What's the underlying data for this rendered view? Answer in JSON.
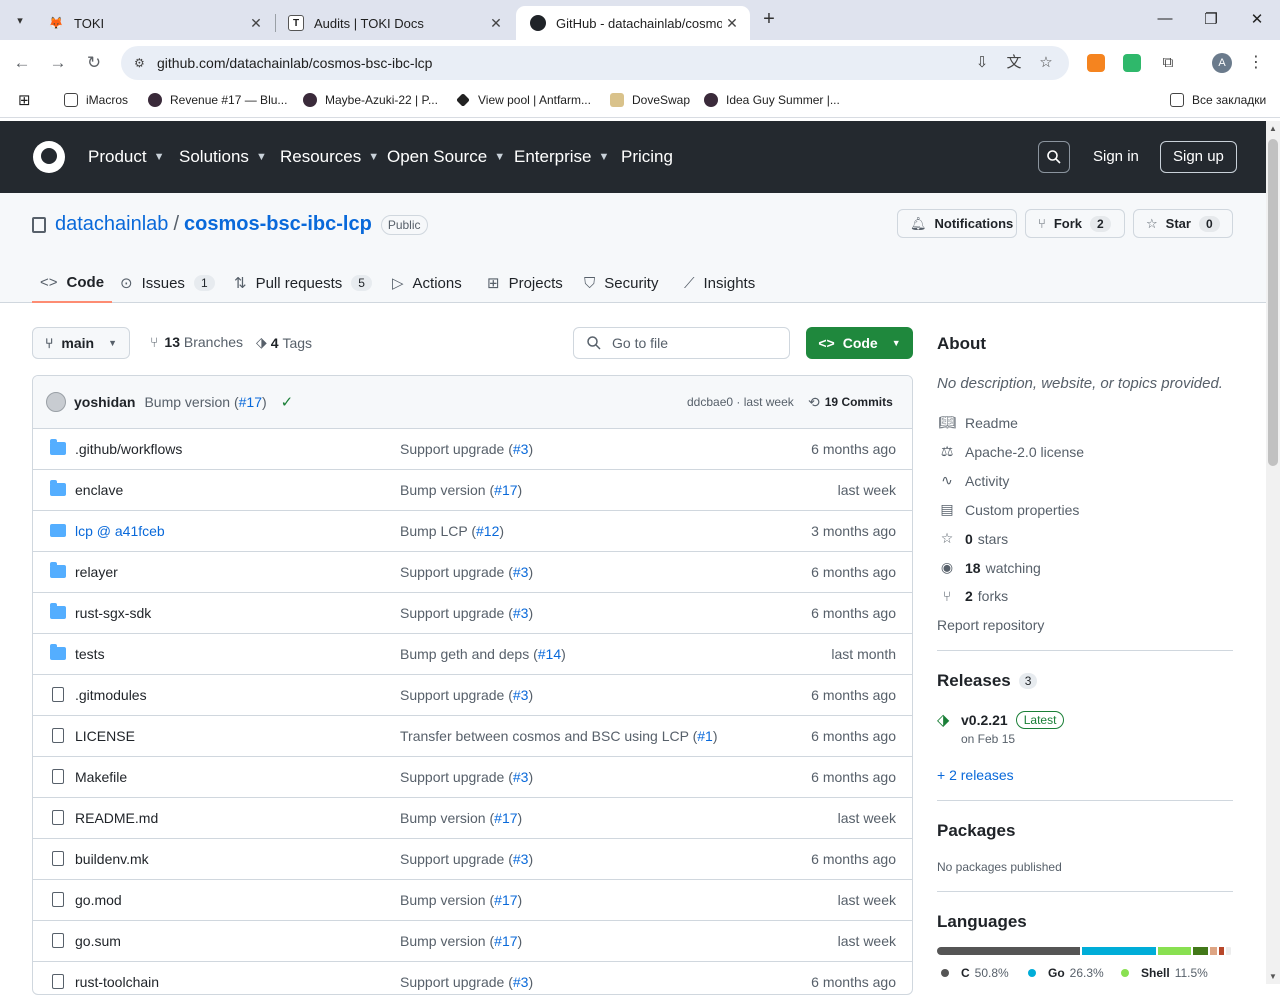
{
  "browser": {
    "tabs": [
      {
        "title": "TOKI",
        "favicon": "toki-fox-icon"
      },
      {
        "title": "Audits | TOKI Docs",
        "favicon": "T"
      },
      {
        "title": "GitHub - datachainlab/cosmos-",
        "favicon": "github-icon"
      }
    ],
    "url": "github.com/datachainlab/cosmos-bsc-ibc-lcp",
    "profile_initial": "A",
    "bookmarks": [
      {
        "label": "iMacros"
      },
      {
        "label": "Revenue #17 — Blu..."
      },
      {
        "label": "Maybe-Azuki-22 | P..."
      },
      {
        "label": "View pool | Antfarm..."
      },
      {
        "label": "DoveSwap"
      },
      {
        "label": "Idea Guy Summer |..."
      }
    ],
    "all_bookmarks": "Все закладки"
  },
  "gh_nav": {
    "product": "Product",
    "solutions": "Solutions",
    "resources": "Resources",
    "open_source": "Open Source",
    "enterprise": "Enterprise",
    "pricing": "Pricing",
    "sign_in": "Sign in",
    "sign_up": "Sign up"
  },
  "repo": {
    "owner": "datachainlab",
    "name": "cosmos-bsc-ibc-lcp",
    "visibility": "Public",
    "notifications": "Notifications",
    "fork_label": "Fork",
    "fork_count": "2",
    "star_label": "Star",
    "star_count": "0"
  },
  "repo_tabs": {
    "code": "Code",
    "issues": "Issues",
    "issues_count": "1",
    "pulls": "Pull requests",
    "pulls_count": "5",
    "actions": "Actions",
    "projects": "Projects",
    "security": "Security",
    "insights": "Insights"
  },
  "controls": {
    "branch": "main",
    "branches_count": "13",
    "branches_label": "Branches",
    "tags_count": "4",
    "tags_label": "Tags",
    "goto_placeholder": "Go to file",
    "code_button": "Code"
  },
  "latest_commit": {
    "author": "yoshidan",
    "message": "Bump version (",
    "pr": "#17",
    "message_end": ")",
    "sha": "ddcbae0",
    "sep": "·",
    "time": "last week",
    "commits_count": "19",
    "commits_label": "Commits"
  },
  "files": [
    {
      "name": ".github/workflows",
      "type": "dir",
      "msg": "Support upgrade (",
      "pr": "#3",
      "age": "6 months ago"
    },
    {
      "name": "enclave",
      "type": "dir",
      "msg": "Bump version (",
      "pr": "#17",
      "age": "last week"
    },
    {
      "name": "lcp @ a41fceb",
      "type": "sub",
      "msg": "Bump LCP (",
      "pr": "#12",
      "age": "3 months ago"
    },
    {
      "name": "relayer",
      "type": "dir",
      "msg": "Support upgrade (",
      "pr": "#3",
      "age": "6 months ago"
    },
    {
      "name": "rust-sgx-sdk",
      "type": "dir",
      "msg": "Support upgrade (",
      "pr": "#3",
      "age": "6 months ago"
    },
    {
      "name": "tests",
      "type": "dir",
      "msg": "Bump geth and deps (",
      "pr": "#14",
      "age": "last month"
    },
    {
      "name": ".gitmodules",
      "type": "file",
      "msg": "Support upgrade (",
      "pr": "#3",
      "age": "6 months ago"
    },
    {
      "name": "LICENSE",
      "type": "file",
      "msg": "Transfer between cosmos and BSC using LCP (",
      "pr": "#1",
      "age": "6 months ago"
    },
    {
      "name": "Makefile",
      "type": "file",
      "msg": "Support upgrade (",
      "pr": "#3",
      "age": "6 months ago"
    },
    {
      "name": "README.md",
      "type": "file",
      "msg": "Bump version (",
      "pr": "#17",
      "age": "last week"
    },
    {
      "name": "buildenv.mk",
      "type": "file",
      "msg": "Support upgrade (",
      "pr": "#3",
      "age": "6 months ago"
    },
    {
      "name": "go.mod",
      "type": "file",
      "msg": "Bump version (",
      "pr": "#17",
      "age": "last week"
    },
    {
      "name": "go.sum",
      "type": "file",
      "msg": "Bump version (",
      "pr": "#17",
      "age": "last week"
    },
    {
      "name": "rust-toolchain",
      "type": "file",
      "msg": "Support upgrade (",
      "pr": "#3",
      "age": "6 months ago"
    }
  ],
  "about": {
    "heading": "About",
    "description": "No description, website, or topics provided.",
    "readme": "Readme",
    "license": "Apache-2.0 license",
    "activity": "Activity",
    "custom_props": "Custom properties",
    "stars_count": "0",
    "stars_label": "stars",
    "watching_count": "18",
    "watching_label": "watching",
    "forks_count": "2",
    "forks_label": "forks",
    "report": "Report repository"
  },
  "releases": {
    "heading": "Releases",
    "count": "3",
    "version": "v0.2.21",
    "latest_badge": "Latest",
    "date": "on Feb 15",
    "more": "+ 2 releases"
  },
  "packages": {
    "heading": "Packages",
    "empty": "No packages published"
  },
  "languages": {
    "heading": "Languages",
    "items": [
      {
        "name": "C",
        "pct": "50.8%",
        "value": 50.8,
        "color": "#555555"
      },
      {
        "name": "Go",
        "pct": "26.3%",
        "value": 26.3,
        "color": "#00ADD8"
      },
      {
        "name": "Shell",
        "pct": "11.5%",
        "value": 11.5,
        "color": "#89e051"
      },
      {
        "name": "",
        "pct": "",
        "value": 5.5,
        "color": "#427819"
      },
      {
        "name": "",
        "pct": "",
        "value": 2.5,
        "color": "#dea584"
      },
      {
        "name": "",
        "pct": "",
        "value": 1.5,
        "color": "#b7472a"
      },
      {
        "name": "",
        "pct": "",
        "value": 1.9,
        "color": "#ededed"
      }
    ]
  }
}
